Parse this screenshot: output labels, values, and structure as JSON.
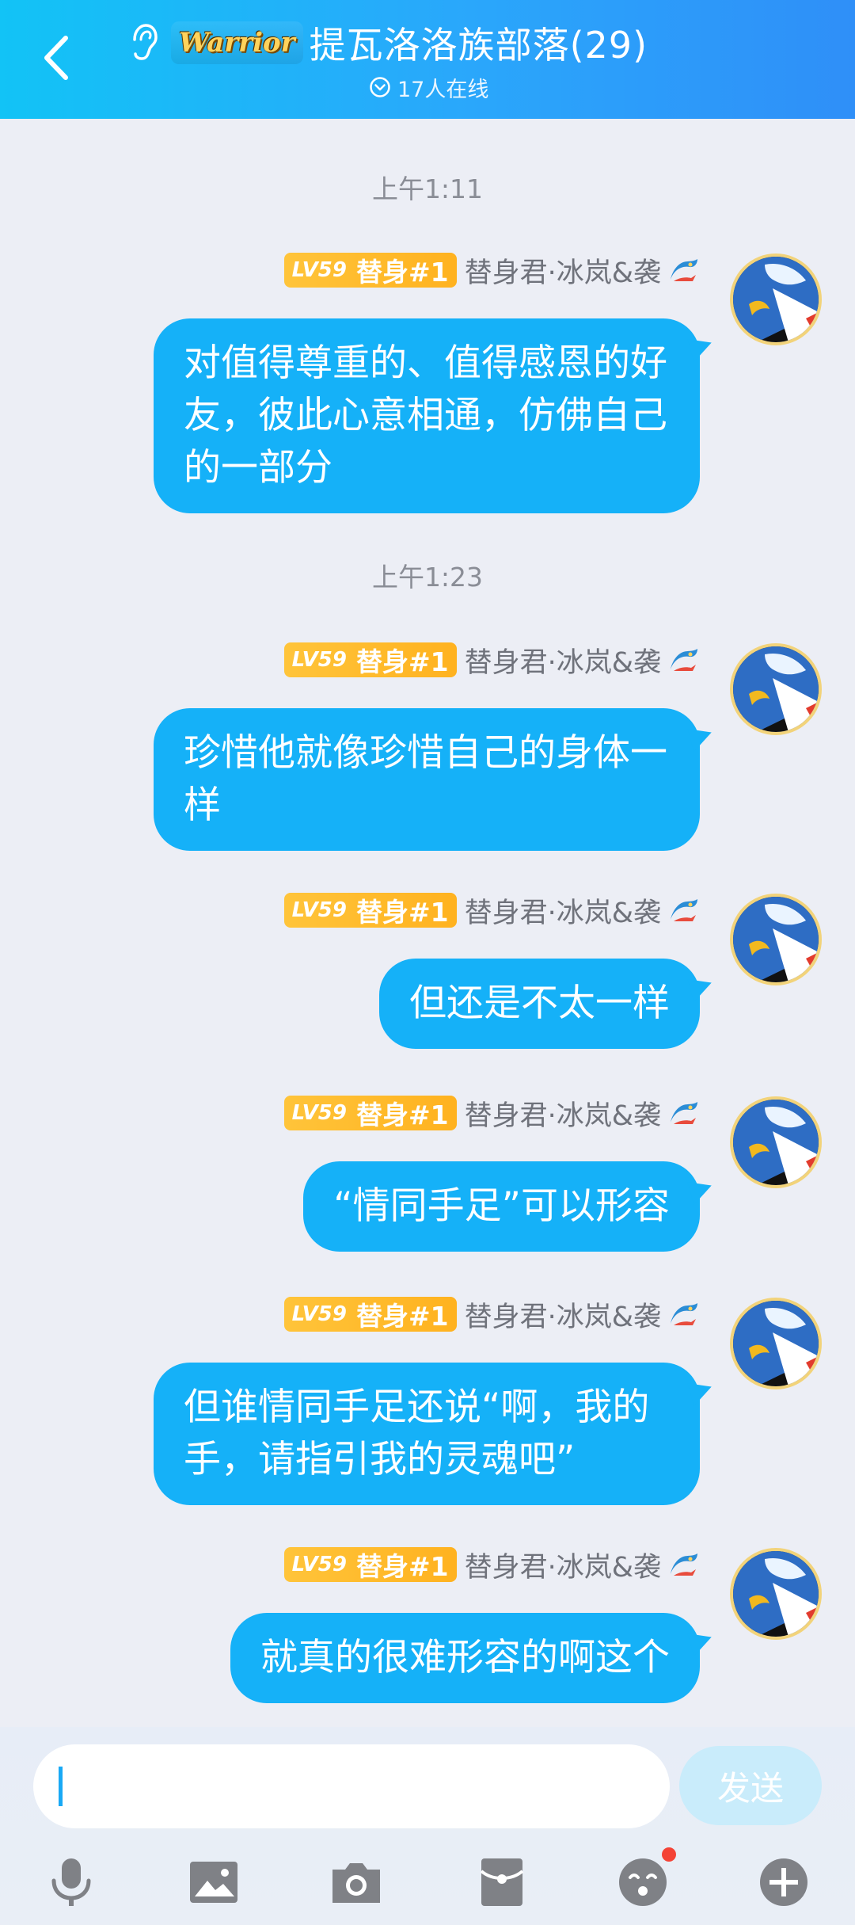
{
  "header": {
    "logo_text": "Warrior",
    "title": "提瓦洛洛族部落(29)",
    "online": "17人在线",
    "icons": {
      "back": "chevron-left-icon",
      "ear": "ear-icon",
      "online": "chevron-down-circle-icon"
    }
  },
  "chat": {
    "times": [
      "上午1:11",
      "上午1:23"
    ],
    "messages": [
      {
        "level": "LV59",
        "rank": "替身#1",
        "nickname": "替身君·冰岚&袭",
        "text": "对值得尊重的、值得感恩的好友，彼此心意相通，仿佛自己的一部分"
      },
      {
        "level": "LV59",
        "rank": "替身#1",
        "nickname": "替身君·冰岚&袭",
        "text": "珍惜他就像珍惜自己的身体一样"
      },
      {
        "level": "LV59",
        "rank": "替身#1",
        "nickname": "替身君·冰岚&袭",
        "text": "但还是不太一样"
      },
      {
        "level": "LV59",
        "rank": "替身#1",
        "nickname": "替身君·冰岚&袭",
        "text": "“情同手足”可以形容"
      },
      {
        "level": "LV59",
        "rank": "替身#1",
        "nickname": "替身君·冰岚&袭",
        "text": "但谁情同手足还说“啊，我的手，请指引我的灵魂吧”"
      },
      {
        "level": "LV59",
        "rank": "替身#1",
        "nickname": "替身君·冰岚&袭",
        "text": "就真的很难形容的啊这个"
      }
    ]
  },
  "input": {
    "value": "",
    "send_label": "发送"
  },
  "toolbar": {
    "items": [
      "microphone-icon",
      "image-icon",
      "camera-icon",
      "red-packet-icon",
      "emoji-icon",
      "plus-icon"
    ]
  },
  "colors": {
    "header_start": "#12c3f6",
    "header_end": "#2f8ff8",
    "bubble": "#15b1f8",
    "badge": "#ffb21f",
    "background": "#eceef5"
  }
}
